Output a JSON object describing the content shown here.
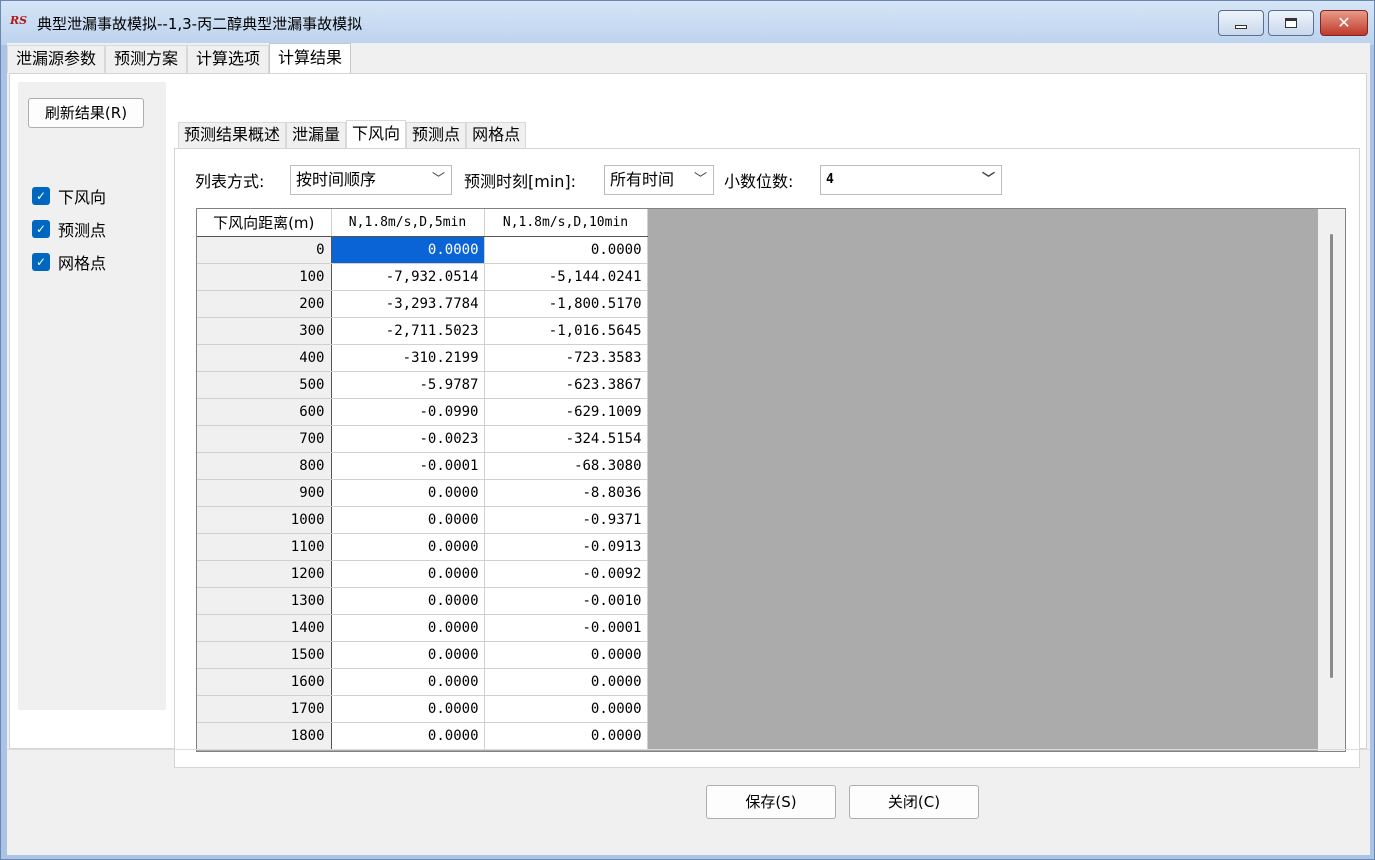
{
  "window": {
    "app_logo": "RS",
    "title": "典型泄漏事故模拟--1,3-丙二醇典型泄漏事故模拟",
    "controls": {
      "minimize": "minimize-icon",
      "maximize": "maximize-icon",
      "close": "close-icon"
    }
  },
  "top_tabs": [
    "泄漏源参数",
    "预测方案",
    "计算选项",
    "计算结果"
  ],
  "top_tab_active": "计算结果",
  "left_pane": {
    "refresh_label": "刷新结果(R)",
    "checks": [
      {
        "label": "下风向",
        "checked": true
      },
      {
        "label": "预测点",
        "checked": true
      },
      {
        "label": "网格点",
        "checked": true
      }
    ]
  },
  "inner_tabs": [
    "预测结果概述",
    "泄漏量",
    "下风向",
    "预测点",
    "网格点"
  ],
  "inner_tab_active": "下风向",
  "options": {
    "list_mode_label": "列表方式:",
    "list_mode_value": "按时间顺序",
    "time_label": "预测时刻[min]:",
    "time_value": "所有时间",
    "decimals_label": "小数位数:",
    "decimals_value": "4"
  },
  "grid": {
    "headers": [
      "下风向距离(m)",
      "N,1.8m/s,D,5min",
      "N,1.8m/s,D,10min"
    ],
    "rows": [
      [
        "0",
        "0.0000",
        "0.0000"
      ],
      [
        "100",
        "-7,932.0514",
        "-5,144.0241"
      ],
      [
        "200",
        "-3,293.7784",
        "-1,800.5170"
      ],
      [
        "300",
        "-2,711.5023",
        "-1,016.5645"
      ],
      [
        "400",
        "-310.2199",
        "-723.3583"
      ],
      [
        "500",
        "-5.9787",
        "-623.3867"
      ],
      [
        "600",
        "-0.0990",
        "-629.1009"
      ],
      [
        "700",
        "-0.0023",
        "-324.5154"
      ],
      [
        "800",
        "-0.0001",
        "-68.3080"
      ],
      [
        "900",
        "0.0000",
        "-8.8036"
      ],
      [
        "1000",
        "0.0000",
        "-0.9371"
      ],
      [
        "1100",
        "0.0000",
        "-0.0913"
      ],
      [
        "1200",
        "0.0000",
        "-0.0092"
      ],
      [
        "1300",
        "0.0000",
        "-0.0010"
      ],
      [
        "1400",
        "0.0000",
        "-0.0001"
      ],
      [
        "1500",
        "0.0000",
        "0.0000"
      ],
      [
        "1600",
        "0.0000",
        "0.0000"
      ],
      [
        "1700",
        "0.0000",
        "0.0000"
      ],
      [
        "1800",
        "0.0000",
        "0.0000"
      ]
    ]
  },
  "buttons": {
    "save": "保存(S)",
    "close": "关闭(C)"
  },
  "colors": {
    "selection": "#0a64d6",
    "checkbox": "#0067c0",
    "close_button": "#c0392b"
  }
}
